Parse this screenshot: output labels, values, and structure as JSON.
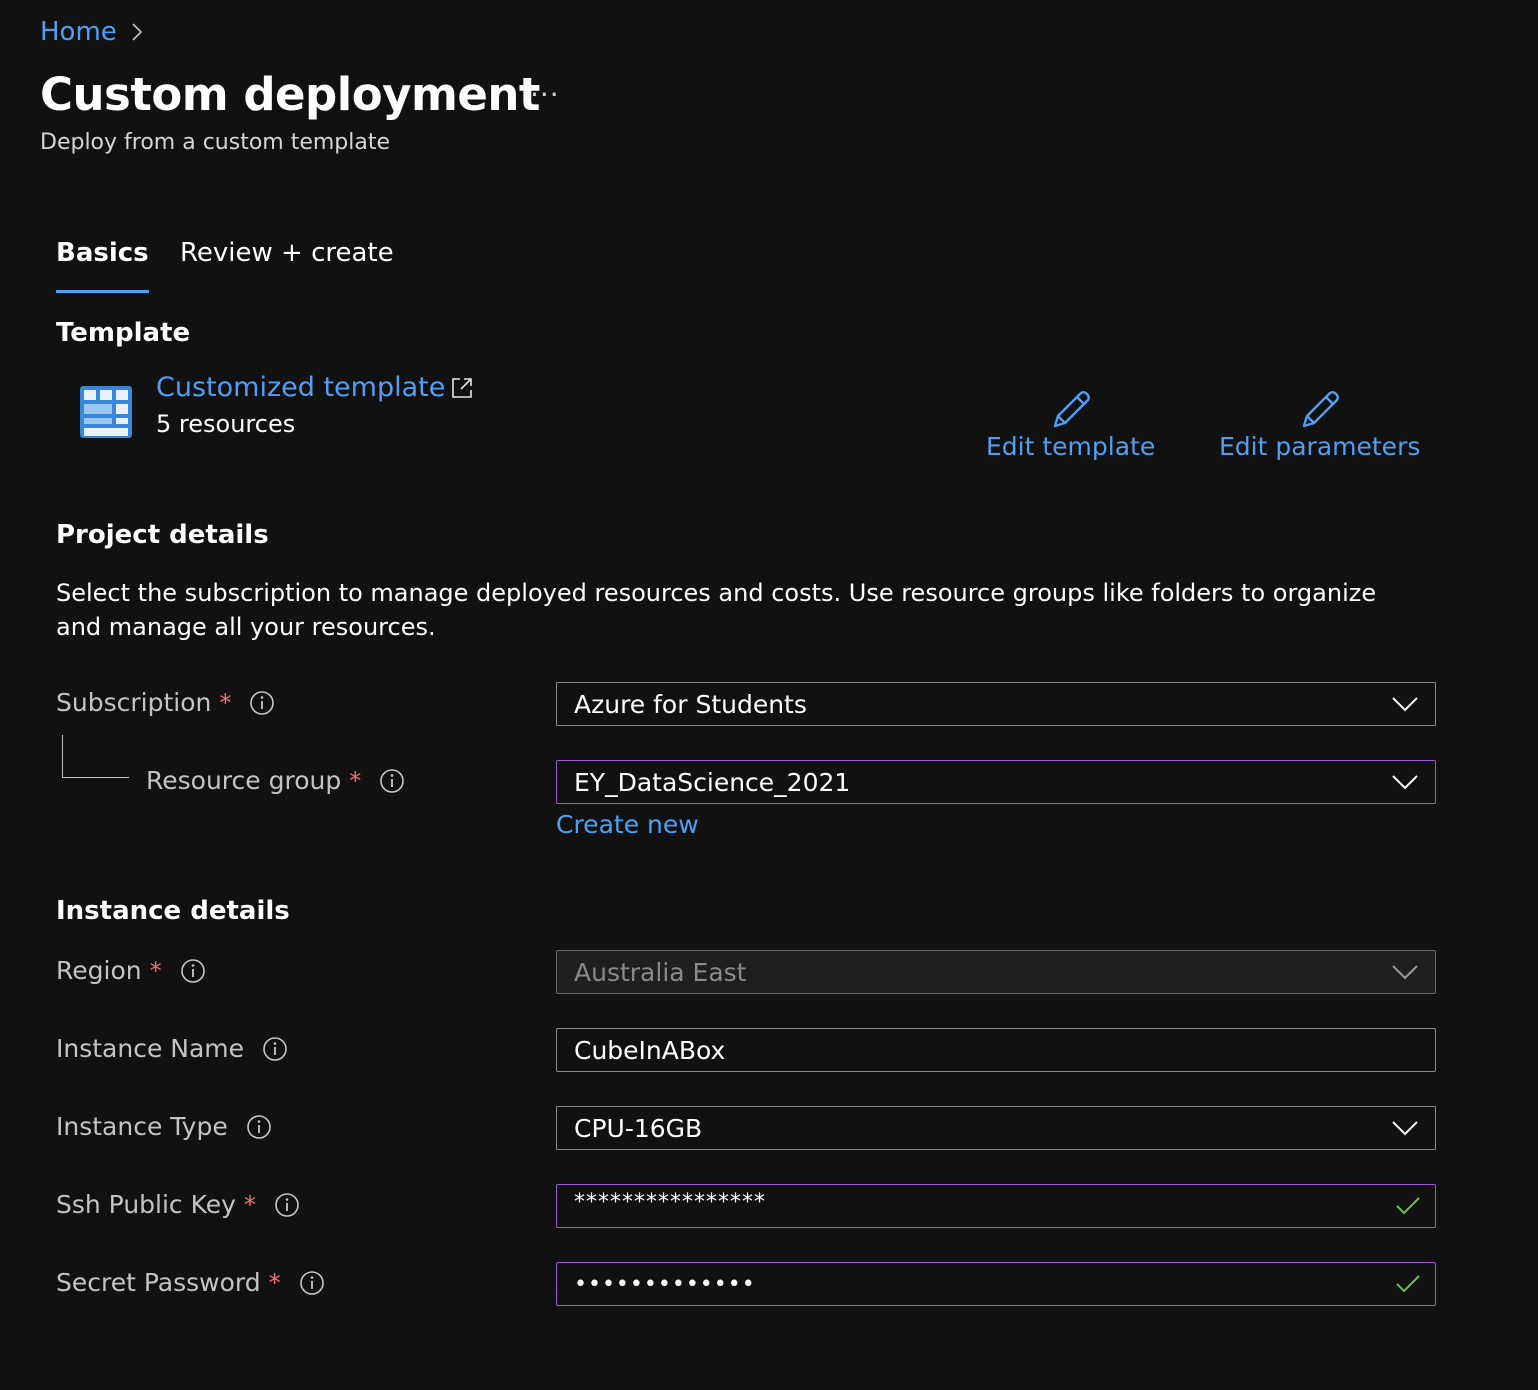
{
  "breadcrumb": {
    "home": "Home"
  },
  "page": {
    "title": "Custom deployment",
    "more": "···",
    "subtitle": "Deploy from a custom template"
  },
  "tabs": [
    {
      "label": "Basics",
      "active": true
    },
    {
      "label": "Review + create",
      "active": false
    }
  ],
  "template": {
    "heading": "Template",
    "link": "Customized template",
    "resources": "5 resources",
    "edit_template": "Edit template",
    "edit_parameters": "Edit parameters"
  },
  "project": {
    "heading": "Project details",
    "description": "Select the subscription to manage deployed resources and costs. Use resource groups like folders to organize and manage all your resources.",
    "subscription": {
      "label": "Subscription",
      "value": "Azure for Students"
    },
    "resource_group": {
      "label": "Resource group",
      "value": "EY_DataScience_2021",
      "create_new": "Create new"
    }
  },
  "instance": {
    "heading": "Instance details",
    "region": {
      "label": "Region",
      "value": "Australia East"
    },
    "instance_name": {
      "label": "Instance Name",
      "value": "CubeInABox"
    },
    "instance_type": {
      "label": "Instance Type",
      "value": "CPU-16GB"
    },
    "ssh_key": {
      "label": "Ssh Public Key",
      "value": "****************"
    },
    "secret_password": {
      "label": "Secret Password",
      "value": "•••••••••••••"
    }
  },
  "required_marker": "*",
  "colors": {
    "background": "#111111",
    "link": "#4f9ff5",
    "focus_border": "#9b5bd0",
    "required": "#f1707b",
    "valid_check": "#6cc04a"
  }
}
